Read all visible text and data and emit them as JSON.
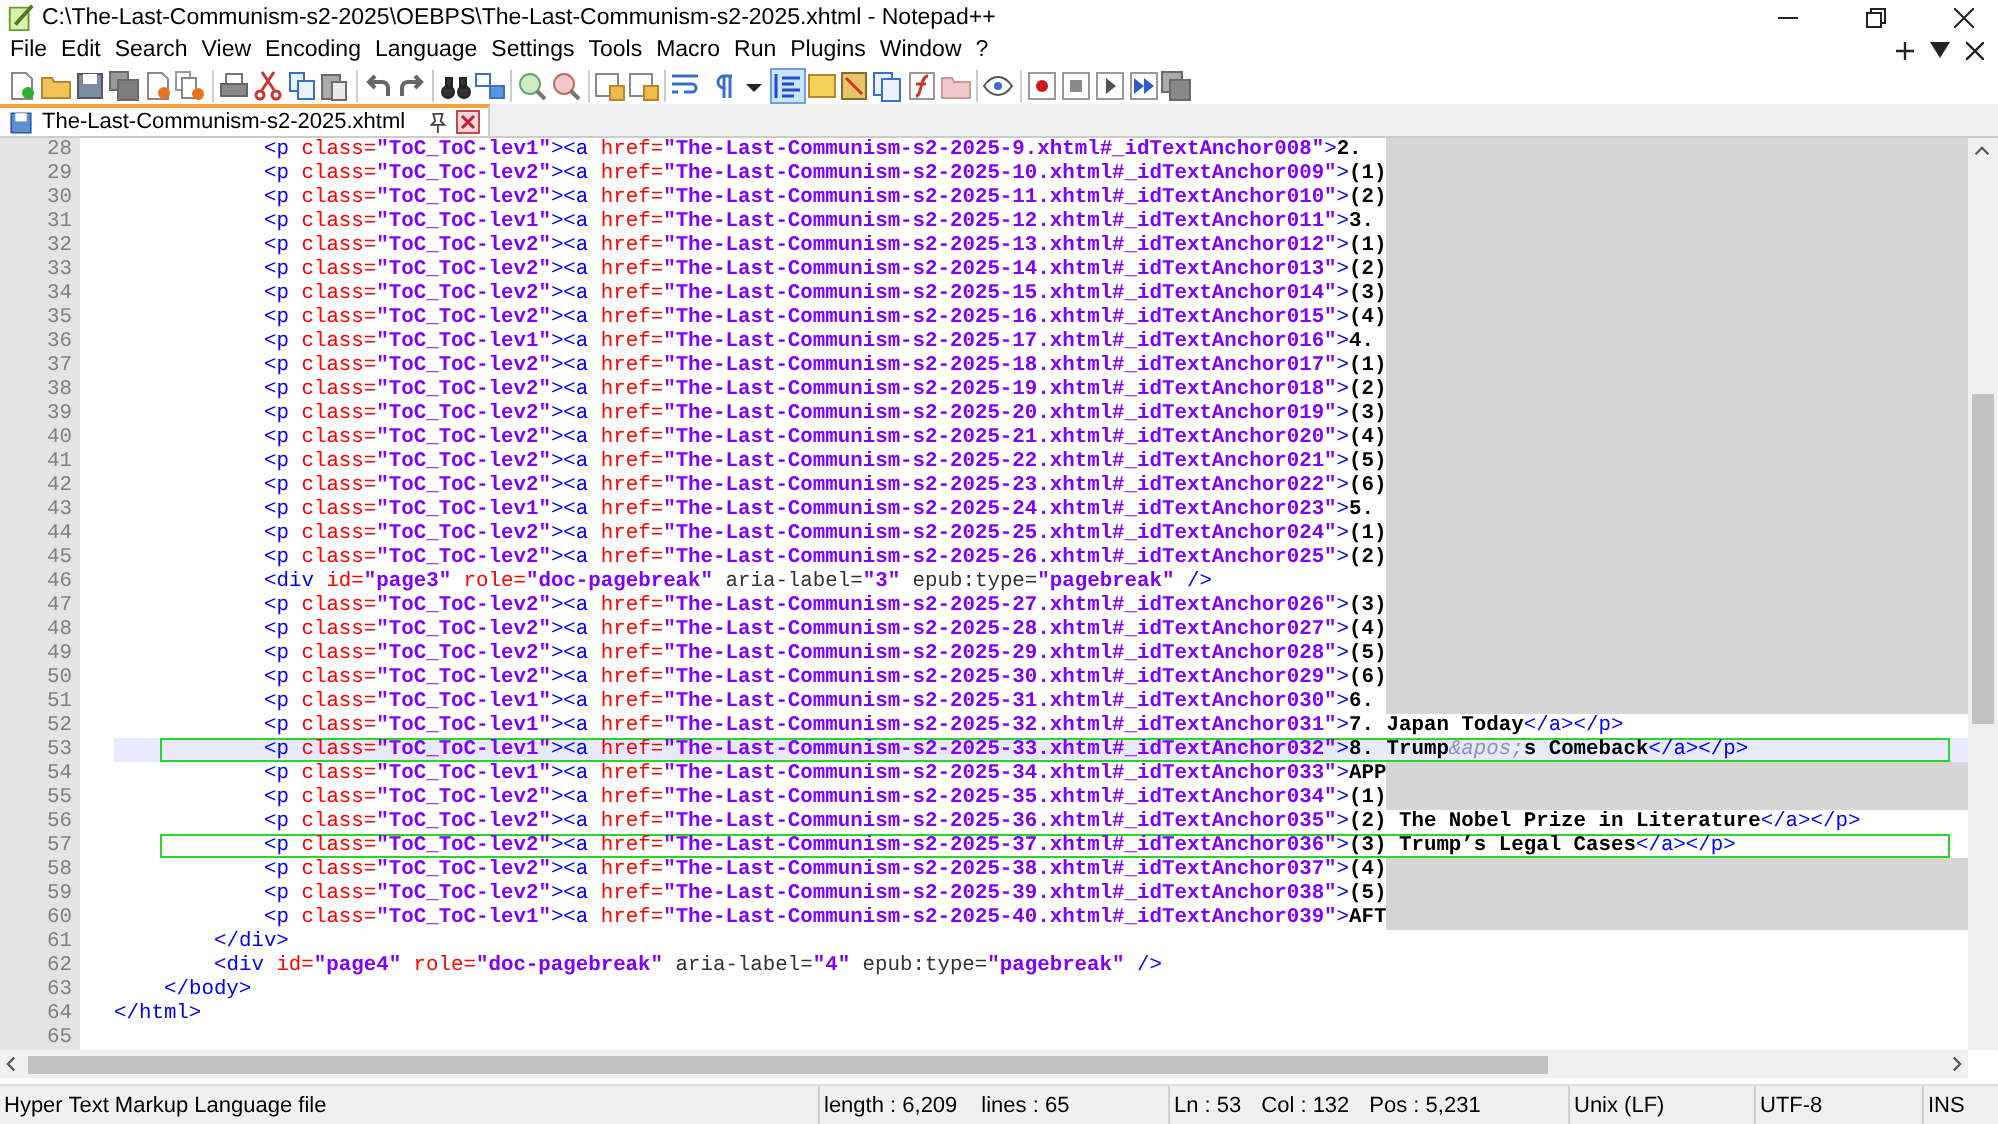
{
  "window": {
    "title": "C:\\The-Last-Communism-s2-2025\\OEBPS\\The-Last-Communism-s2-2025.xhtml - Notepad++"
  },
  "menu": [
    "File",
    "Edit",
    "Search",
    "View",
    "Encoding",
    "Language",
    "Settings",
    "Tools",
    "Macro",
    "Run",
    "Plugins",
    "Window",
    "?"
  ],
  "toolbar": {
    "indent_guide_selected": true
  },
  "tabs": [
    {
      "label": "The-Last-Communism-s2-2025.xhtml",
      "selected": true
    }
  ],
  "editor": {
    "lines": [
      {
        "num": "28",
        "current": false,
        "boxed": false,
        "redacted": true,
        "tokens": [
          {
            "kind": "tag",
            "text": "\t\t\t<p"
          },
          {
            "kind": "attr",
            "text": " class="
          },
          {
            "kind": "value",
            "text": "\"ToC_ToC-lev1\""
          },
          {
            "kind": "tag",
            "text": "><a"
          },
          {
            "kind": "attr",
            "text": " href="
          },
          {
            "kind": "value",
            "text": "\"The-Last-Communism-s2-2025-9.xhtml#_idTextAnchor008\""
          },
          {
            "kind": "tag",
            "text": ">"
          },
          {
            "kind": "text",
            "text": "2."
          }
        ]
      },
      {
        "num": "29",
        "current": false,
        "boxed": false,
        "redacted": true,
        "tokens": [
          {
            "kind": "tag",
            "text": "\t\t\t<p"
          },
          {
            "kind": "attr",
            "text": " class="
          },
          {
            "kind": "value",
            "text": "\"ToC_ToC-lev2\""
          },
          {
            "kind": "tag",
            "text": "><a"
          },
          {
            "kind": "attr",
            "text": " href="
          },
          {
            "kind": "value",
            "text": "\"The-Last-Communism-s2-2025-10.xhtml#_idTextAnchor009\""
          },
          {
            "kind": "tag",
            "text": ">"
          },
          {
            "kind": "text",
            "text": "(1)"
          }
        ]
      },
      {
        "num": "30",
        "current": false,
        "boxed": false,
        "redacted": true,
        "tokens": [
          {
            "kind": "tag",
            "text": "\t\t\t<p"
          },
          {
            "kind": "attr",
            "text": " class="
          },
          {
            "kind": "value",
            "text": "\"ToC_ToC-lev2\""
          },
          {
            "kind": "tag",
            "text": "><a"
          },
          {
            "kind": "attr",
            "text": " href="
          },
          {
            "kind": "value",
            "text": "\"The-Last-Communism-s2-2025-11.xhtml#_idTextAnchor010\""
          },
          {
            "kind": "tag",
            "text": ">"
          },
          {
            "kind": "text",
            "text": "(2)"
          }
        ]
      },
      {
        "num": "31",
        "current": false,
        "boxed": false,
        "redacted": true,
        "tokens": [
          {
            "kind": "tag",
            "text": "\t\t\t<p"
          },
          {
            "kind": "attr",
            "text": " class="
          },
          {
            "kind": "value",
            "text": "\"ToC_ToC-lev1\""
          },
          {
            "kind": "tag",
            "text": "><a"
          },
          {
            "kind": "attr",
            "text": " href="
          },
          {
            "kind": "value",
            "text": "\"The-Last-Communism-s2-2025-12.xhtml#_idTextAnchor011\""
          },
          {
            "kind": "tag",
            "text": ">"
          },
          {
            "kind": "text",
            "text": "3."
          }
        ]
      },
      {
        "num": "32",
        "current": false,
        "boxed": false,
        "redacted": true,
        "tokens": [
          {
            "kind": "tag",
            "text": "\t\t\t<p"
          },
          {
            "kind": "attr",
            "text": " class="
          },
          {
            "kind": "value",
            "text": "\"ToC_ToC-lev2\""
          },
          {
            "kind": "tag",
            "text": "><a"
          },
          {
            "kind": "attr",
            "text": " href="
          },
          {
            "kind": "value",
            "text": "\"The-Last-Communism-s2-2025-13.xhtml#_idTextAnchor012\""
          },
          {
            "kind": "tag",
            "text": ">"
          },
          {
            "kind": "text",
            "text": "(1)"
          }
        ]
      },
      {
        "num": "33",
        "current": false,
        "boxed": false,
        "redacted": true,
        "tokens": [
          {
            "kind": "tag",
            "text": "\t\t\t<p"
          },
          {
            "kind": "attr",
            "text": " class="
          },
          {
            "kind": "value",
            "text": "\"ToC_ToC-lev2\""
          },
          {
            "kind": "tag",
            "text": "><a"
          },
          {
            "kind": "attr",
            "text": " href="
          },
          {
            "kind": "value",
            "text": "\"The-Last-Communism-s2-2025-14.xhtml#_idTextAnchor013\""
          },
          {
            "kind": "tag",
            "text": ">"
          },
          {
            "kind": "text",
            "text": "(2)"
          }
        ]
      },
      {
        "num": "34",
        "current": false,
        "boxed": false,
        "redacted": true,
        "tokens": [
          {
            "kind": "tag",
            "text": "\t\t\t<p"
          },
          {
            "kind": "attr",
            "text": " class="
          },
          {
            "kind": "value",
            "text": "\"ToC_ToC-lev2\""
          },
          {
            "kind": "tag",
            "text": "><a"
          },
          {
            "kind": "attr",
            "text": " href="
          },
          {
            "kind": "value",
            "text": "\"The-Last-Communism-s2-2025-15.xhtml#_idTextAnchor014\""
          },
          {
            "kind": "tag",
            "text": ">"
          },
          {
            "kind": "text",
            "text": "(3)"
          }
        ]
      },
      {
        "num": "35",
        "current": false,
        "boxed": false,
        "redacted": true,
        "tokens": [
          {
            "kind": "tag",
            "text": "\t\t\t<p"
          },
          {
            "kind": "attr",
            "text": " class="
          },
          {
            "kind": "value",
            "text": "\"ToC_ToC-lev2\""
          },
          {
            "kind": "tag",
            "text": "><a"
          },
          {
            "kind": "attr",
            "text": " href="
          },
          {
            "kind": "value",
            "text": "\"The-Last-Communism-s2-2025-16.xhtml#_idTextAnchor015\""
          },
          {
            "kind": "tag",
            "text": ">"
          },
          {
            "kind": "text",
            "text": "(4)"
          }
        ]
      },
      {
        "num": "36",
        "current": false,
        "boxed": false,
        "redacted": true,
        "tokens": [
          {
            "kind": "tag",
            "text": "\t\t\t<p"
          },
          {
            "kind": "attr",
            "text": " class="
          },
          {
            "kind": "value",
            "text": "\"ToC_ToC-lev1\""
          },
          {
            "kind": "tag",
            "text": "><a"
          },
          {
            "kind": "attr",
            "text": " href="
          },
          {
            "kind": "value",
            "text": "\"The-Last-Communism-s2-2025-17.xhtml#_idTextAnchor016\""
          },
          {
            "kind": "tag",
            "text": ">"
          },
          {
            "kind": "text",
            "text": "4."
          }
        ]
      },
      {
        "num": "37",
        "current": false,
        "boxed": false,
        "redacted": true,
        "tokens": [
          {
            "kind": "tag",
            "text": "\t\t\t<p"
          },
          {
            "kind": "attr",
            "text": " class="
          },
          {
            "kind": "value",
            "text": "\"ToC_ToC-lev2\""
          },
          {
            "kind": "tag",
            "text": "><a"
          },
          {
            "kind": "attr",
            "text": " href="
          },
          {
            "kind": "value",
            "text": "\"The-Last-Communism-s2-2025-18.xhtml#_idTextAnchor017\""
          },
          {
            "kind": "tag",
            "text": ">"
          },
          {
            "kind": "text",
            "text": "(1)"
          }
        ]
      },
      {
        "num": "38",
        "current": false,
        "boxed": false,
        "redacted": true,
        "tokens": [
          {
            "kind": "tag",
            "text": "\t\t\t<p"
          },
          {
            "kind": "attr",
            "text": " class="
          },
          {
            "kind": "value",
            "text": "\"ToC_ToC-lev2\""
          },
          {
            "kind": "tag",
            "text": "><a"
          },
          {
            "kind": "attr",
            "text": " href="
          },
          {
            "kind": "value",
            "text": "\"The-Last-Communism-s2-2025-19.xhtml#_idTextAnchor018\""
          },
          {
            "kind": "tag",
            "text": ">"
          },
          {
            "kind": "text",
            "text": "(2)"
          }
        ]
      },
      {
        "num": "39",
        "current": false,
        "boxed": false,
        "redacted": true,
        "tokens": [
          {
            "kind": "tag",
            "text": "\t\t\t<p"
          },
          {
            "kind": "attr",
            "text": " class="
          },
          {
            "kind": "value",
            "text": "\"ToC_ToC-lev2\""
          },
          {
            "kind": "tag",
            "text": "><a"
          },
          {
            "kind": "attr",
            "text": " href="
          },
          {
            "kind": "value",
            "text": "\"The-Last-Communism-s2-2025-20.xhtml#_idTextAnchor019\""
          },
          {
            "kind": "tag",
            "text": ">"
          },
          {
            "kind": "text",
            "text": "(3)"
          }
        ]
      },
      {
        "num": "40",
        "current": false,
        "boxed": false,
        "redacted": true,
        "tokens": [
          {
            "kind": "tag",
            "text": "\t\t\t<p"
          },
          {
            "kind": "attr",
            "text": " class="
          },
          {
            "kind": "value",
            "text": "\"ToC_ToC-lev2\""
          },
          {
            "kind": "tag",
            "text": "><a"
          },
          {
            "kind": "attr",
            "text": " href="
          },
          {
            "kind": "value",
            "text": "\"The-Last-Communism-s2-2025-21.xhtml#_idTextAnchor020\""
          },
          {
            "kind": "tag",
            "text": ">"
          },
          {
            "kind": "text",
            "text": "(4)"
          }
        ]
      },
      {
        "num": "41",
        "current": false,
        "boxed": false,
        "redacted": true,
        "tokens": [
          {
            "kind": "tag",
            "text": "\t\t\t<p"
          },
          {
            "kind": "attr",
            "text": " class="
          },
          {
            "kind": "value",
            "text": "\"ToC_ToC-lev2\""
          },
          {
            "kind": "tag",
            "text": "><a"
          },
          {
            "kind": "attr",
            "text": " href="
          },
          {
            "kind": "value",
            "text": "\"The-Last-Communism-s2-2025-22.xhtml#_idTextAnchor021\""
          },
          {
            "kind": "tag",
            "text": ">"
          },
          {
            "kind": "text",
            "text": "(5)"
          }
        ]
      },
      {
        "num": "42",
        "current": false,
        "boxed": false,
        "redacted": true,
        "tokens": [
          {
            "kind": "tag",
            "text": "\t\t\t<p"
          },
          {
            "kind": "attr",
            "text": " class="
          },
          {
            "kind": "value",
            "text": "\"ToC_ToC-lev2\""
          },
          {
            "kind": "tag",
            "text": "><a"
          },
          {
            "kind": "attr",
            "text": " href="
          },
          {
            "kind": "value",
            "text": "\"The-Last-Communism-s2-2025-23.xhtml#_idTextAnchor022\""
          },
          {
            "kind": "tag",
            "text": ">"
          },
          {
            "kind": "text",
            "text": "(6)"
          }
        ]
      },
      {
        "num": "43",
        "current": false,
        "boxed": false,
        "redacted": true,
        "tokens": [
          {
            "kind": "tag",
            "text": "\t\t\t<p"
          },
          {
            "kind": "attr",
            "text": " class="
          },
          {
            "kind": "value",
            "text": "\"ToC_ToC-lev1\""
          },
          {
            "kind": "tag",
            "text": "><a"
          },
          {
            "kind": "attr",
            "text": " href="
          },
          {
            "kind": "value",
            "text": "\"The-Last-Communism-s2-2025-24.xhtml#_idTextAnchor023\""
          },
          {
            "kind": "tag",
            "text": ">"
          },
          {
            "kind": "text",
            "text": "5."
          }
        ]
      },
      {
        "num": "44",
        "current": false,
        "boxed": false,
        "redacted": true,
        "tokens": [
          {
            "kind": "tag",
            "text": "\t\t\t<p"
          },
          {
            "kind": "attr",
            "text": " class="
          },
          {
            "kind": "value",
            "text": "\"ToC_ToC-lev2\""
          },
          {
            "kind": "tag",
            "text": "><a"
          },
          {
            "kind": "attr",
            "text": " href="
          },
          {
            "kind": "value",
            "text": "\"The-Last-Communism-s2-2025-25.xhtml#_idTextAnchor024\""
          },
          {
            "kind": "tag",
            "text": ">"
          },
          {
            "kind": "text",
            "text": "(1)"
          }
        ]
      },
      {
        "num": "45",
        "current": false,
        "boxed": false,
        "redacted": true,
        "tokens": [
          {
            "kind": "tag",
            "text": "\t\t\t<p"
          },
          {
            "kind": "attr",
            "text": " class="
          },
          {
            "kind": "value",
            "text": "\"ToC_ToC-lev2\""
          },
          {
            "kind": "tag",
            "text": "><a"
          },
          {
            "kind": "attr",
            "text": " href="
          },
          {
            "kind": "value",
            "text": "\"The-Last-Communism-s2-2025-26.xhtml#_idTextAnchor025\""
          },
          {
            "kind": "tag",
            "text": ">"
          },
          {
            "kind": "text",
            "text": "(2)"
          }
        ]
      },
      {
        "num": "46",
        "current": false,
        "boxed": false,
        "redacted": true,
        "tokens": [
          {
            "kind": "tag",
            "text": "\t\t\t<div"
          },
          {
            "kind": "attr",
            "text": " id="
          },
          {
            "kind": "value",
            "text": "\"page3\""
          },
          {
            "kind": "attr",
            "text": " role="
          },
          {
            "kind": "value",
            "text": "\"doc-pagebreak\""
          },
          {
            "kind": "other",
            "text": " aria-label="
          },
          {
            "kind": "value",
            "text": "\"3\""
          },
          {
            "kind": "other",
            "text": " epub:type="
          },
          {
            "kind": "value",
            "text": "\"pagebreak\""
          },
          {
            "kind": "tag",
            "text": " />"
          }
        ]
      },
      {
        "num": "47",
        "current": false,
        "boxed": false,
        "redacted": true,
        "tokens": [
          {
            "kind": "tag",
            "text": "\t\t\t<p"
          },
          {
            "kind": "attr",
            "text": " class="
          },
          {
            "kind": "value",
            "text": "\"ToC_ToC-lev2\""
          },
          {
            "kind": "tag",
            "text": "><a"
          },
          {
            "kind": "attr",
            "text": " href="
          },
          {
            "kind": "value",
            "text": "\"The-Last-Communism-s2-2025-27.xhtml#_idTextAnchor026\""
          },
          {
            "kind": "tag",
            "text": ">"
          },
          {
            "kind": "text",
            "text": "(3)"
          }
        ]
      },
      {
        "num": "48",
        "current": false,
        "boxed": false,
        "redacted": true,
        "tokens": [
          {
            "kind": "tag",
            "text": "\t\t\t<p"
          },
          {
            "kind": "attr",
            "text": " class="
          },
          {
            "kind": "value",
            "text": "\"ToC_ToC-lev2\""
          },
          {
            "kind": "tag",
            "text": "><a"
          },
          {
            "kind": "attr",
            "text": " href="
          },
          {
            "kind": "value",
            "text": "\"The-Last-Communism-s2-2025-28.xhtml#_idTextAnchor027\""
          },
          {
            "kind": "tag",
            "text": ">"
          },
          {
            "kind": "text",
            "text": "(4)"
          }
        ]
      },
      {
        "num": "49",
        "current": false,
        "boxed": false,
        "redacted": true,
        "tokens": [
          {
            "kind": "tag",
            "text": "\t\t\t<p"
          },
          {
            "kind": "attr",
            "text": " class="
          },
          {
            "kind": "value",
            "text": "\"ToC_ToC-lev2\""
          },
          {
            "kind": "tag",
            "text": "><a"
          },
          {
            "kind": "attr",
            "text": " href="
          },
          {
            "kind": "value",
            "text": "\"The-Last-Communism-s2-2025-29.xhtml#_idTextAnchor028\""
          },
          {
            "kind": "tag",
            "text": ">"
          },
          {
            "kind": "text",
            "text": "(5)"
          }
        ]
      },
      {
        "num": "50",
        "current": false,
        "boxed": false,
        "redacted": true,
        "tokens": [
          {
            "kind": "tag",
            "text": "\t\t\t<p"
          },
          {
            "kind": "attr",
            "text": " class="
          },
          {
            "kind": "value",
            "text": "\"ToC_ToC-lev2\""
          },
          {
            "kind": "tag",
            "text": "><a"
          },
          {
            "kind": "attr",
            "text": " href="
          },
          {
            "kind": "value",
            "text": "\"The-Last-Communism-s2-2025-30.xhtml#_idTextAnchor029\""
          },
          {
            "kind": "tag",
            "text": ">"
          },
          {
            "kind": "text",
            "text": "(6)"
          }
        ]
      },
      {
        "num": "51",
        "current": false,
        "boxed": false,
        "redacted": true,
        "tokens": [
          {
            "kind": "tag",
            "text": "\t\t\t<p"
          },
          {
            "kind": "attr",
            "text": " class="
          },
          {
            "kind": "value",
            "text": "\"ToC_ToC-lev1\""
          },
          {
            "kind": "tag",
            "text": "><a"
          },
          {
            "kind": "attr",
            "text": " href="
          },
          {
            "kind": "value",
            "text": "\"The-Last-Communism-s2-2025-31.xhtml#_idTextAnchor030\""
          },
          {
            "kind": "tag",
            "text": ">"
          },
          {
            "kind": "text",
            "text": "6."
          }
        ]
      },
      {
        "num": "52",
        "current": false,
        "boxed": false,
        "redacted": false,
        "tokens": [
          {
            "kind": "tag",
            "text": "\t\t\t<p"
          },
          {
            "kind": "attr",
            "text": " class="
          },
          {
            "kind": "value",
            "text": "\"ToC_ToC-lev1\""
          },
          {
            "kind": "tag",
            "text": "><a"
          },
          {
            "kind": "attr",
            "text": " href="
          },
          {
            "kind": "value",
            "text": "\"The-Last-Communism-s2-2025-32.xhtml#_idTextAnchor031\""
          },
          {
            "kind": "tag",
            "text": ">"
          },
          {
            "kind": "text",
            "text": "7. Japan Today"
          },
          {
            "kind": "tag",
            "text": "</a></p>"
          }
        ]
      },
      {
        "num": "53",
        "current": true,
        "boxed": true,
        "redacted": false,
        "tokens": [
          {
            "kind": "tag",
            "text": "\t\t\t<p"
          },
          {
            "kind": "attr",
            "text": " class="
          },
          {
            "kind": "value",
            "text": "\"ToC_ToC-lev1\""
          },
          {
            "kind": "tag",
            "text": "><a"
          },
          {
            "kind": "attr",
            "text": " href="
          },
          {
            "kind": "value",
            "text": "\"The-Last-Communism-s2-2025-33.xhtml#_idTextAnchor032\""
          },
          {
            "kind": "tag",
            "text": ">"
          },
          {
            "kind": "text",
            "text": "8. Trump"
          },
          {
            "kind": "entity",
            "text": "&apos;"
          },
          {
            "kind": "text",
            "text": "s Comeback"
          },
          {
            "kind": "tag",
            "text": "</a></p>"
          }
        ]
      },
      {
        "num": "54",
        "current": false,
        "boxed": false,
        "redacted": true,
        "tokens": [
          {
            "kind": "tag",
            "text": "\t\t\t<p"
          },
          {
            "kind": "attr",
            "text": " class="
          },
          {
            "kind": "value",
            "text": "\"ToC_ToC-lev1\""
          },
          {
            "kind": "tag",
            "text": "><a"
          },
          {
            "kind": "attr",
            "text": " href="
          },
          {
            "kind": "value",
            "text": "\"The-Last-Communism-s2-2025-34.xhtml#_idTextAnchor033\""
          },
          {
            "kind": "tag",
            "text": ">"
          },
          {
            "kind": "text",
            "text": "APP"
          }
        ]
      },
      {
        "num": "55",
        "current": false,
        "boxed": false,
        "redacted": true,
        "tokens": [
          {
            "kind": "tag",
            "text": "\t\t\t<p"
          },
          {
            "kind": "attr",
            "text": " class="
          },
          {
            "kind": "value",
            "text": "\"ToC_ToC-lev2\""
          },
          {
            "kind": "tag",
            "text": "><a"
          },
          {
            "kind": "attr",
            "text": " href="
          },
          {
            "kind": "value",
            "text": "\"The-Last-Communism-s2-2025-35.xhtml#_idTextAnchor034\""
          },
          {
            "kind": "tag",
            "text": ">"
          },
          {
            "kind": "text",
            "text": "(1)"
          }
        ]
      },
      {
        "num": "56",
        "current": false,
        "boxed": false,
        "redacted": false,
        "tokens": [
          {
            "kind": "tag",
            "text": "\t\t\t<p"
          },
          {
            "kind": "attr",
            "text": " class="
          },
          {
            "kind": "value",
            "text": "\"ToC_ToC-lev2\""
          },
          {
            "kind": "tag",
            "text": "><a"
          },
          {
            "kind": "attr",
            "text": " href="
          },
          {
            "kind": "value",
            "text": "\"The-Last-Communism-s2-2025-36.xhtml#_idTextAnchor035\""
          },
          {
            "kind": "tag",
            "text": ">"
          },
          {
            "kind": "text",
            "text": "(2) The Nobel Prize in Literature"
          },
          {
            "kind": "tag",
            "text": "</a></p>"
          }
        ]
      },
      {
        "num": "57",
        "current": false,
        "boxed": true,
        "redacted": false,
        "tokens": [
          {
            "kind": "tag",
            "text": "\t\t\t<p"
          },
          {
            "kind": "attr",
            "text": " class="
          },
          {
            "kind": "value",
            "text": "\"ToC_ToC-lev2\""
          },
          {
            "kind": "tag",
            "text": "><a"
          },
          {
            "kind": "attr",
            "text": " href="
          },
          {
            "kind": "value",
            "text": "\"The-Last-Communism-s2-2025-37.xhtml#_idTextAnchor036\""
          },
          {
            "kind": "tag",
            "text": ">"
          },
          {
            "kind": "text",
            "text": "(3) Trump’s Legal Cases"
          },
          {
            "kind": "tag",
            "text": "</a></p>"
          }
        ]
      },
      {
        "num": "58",
        "current": false,
        "boxed": false,
        "redacted": true,
        "tokens": [
          {
            "kind": "tag",
            "text": "\t\t\t<p"
          },
          {
            "kind": "attr",
            "text": " class="
          },
          {
            "kind": "value",
            "text": "\"ToC_ToC-lev2\""
          },
          {
            "kind": "tag",
            "text": "><a"
          },
          {
            "kind": "attr",
            "text": " href="
          },
          {
            "kind": "value",
            "text": "\"The-Last-Communism-s2-2025-38.xhtml#_idTextAnchor037\""
          },
          {
            "kind": "tag",
            "text": ">"
          },
          {
            "kind": "text",
            "text": "(4)"
          }
        ]
      },
      {
        "num": "59",
        "current": false,
        "boxed": false,
        "redacted": true,
        "tokens": [
          {
            "kind": "tag",
            "text": "\t\t\t<p"
          },
          {
            "kind": "attr",
            "text": " class="
          },
          {
            "kind": "value",
            "text": "\"ToC_ToC-lev2\""
          },
          {
            "kind": "tag",
            "text": "><a"
          },
          {
            "kind": "attr",
            "text": " href="
          },
          {
            "kind": "value",
            "text": "\"The-Last-Communism-s2-2025-39.xhtml#_idTextAnchor038\""
          },
          {
            "kind": "tag",
            "text": ">"
          },
          {
            "kind": "text",
            "text": "(5)"
          }
        ]
      },
      {
        "num": "60",
        "current": false,
        "boxed": false,
        "redacted": true,
        "tokens": [
          {
            "kind": "tag",
            "text": "\t\t\t<p"
          },
          {
            "kind": "attr",
            "text": " class="
          },
          {
            "kind": "value",
            "text": "\"ToC_ToC-lev1\""
          },
          {
            "kind": "tag",
            "text": "><a"
          },
          {
            "kind": "attr",
            "text": " href="
          },
          {
            "kind": "value",
            "text": "\"The-Last-Communism-s2-2025-40.xhtml#_idTextAnchor039\""
          },
          {
            "kind": "tag",
            "text": ">"
          },
          {
            "kind": "text",
            "text": "AFT"
          }
        ]
      },
      {
        "num": "61",
        "current": false,
        "boxed": false,
        "redacted": false,
        "tokens": [
          {
            "kind": "tag",
            "text": "\t\t</div>"
          }
        ]
      },
      {
        "num": "62",
        "current": false,
        "boxed": false,
        "redacted": false,
        "tokens": [
          {
            "kind": "tag",
            "text": "\t\t<div"
          },
          {
            "kind": "attr",
            "text": " id="
          },
          {
            "kind": "value",
            "text": "\"page4\""
          },
          {
            "kind": "attr",
            "text": " role="
          },
          {
            "kind": "value",
            "text": "\"doc-pagebreak\""
          },
          {
            "kind": "other",
            "text": " aria-label="
          },
          {
            "kind": "value",
            "text": "\"4\""
          },
          {
            "kind": "other",
            "text": " epub:type="
          },
          {
            "kind": "value",
            "text": "\"pagebreak\""
          },
          {
            "kind": "tag",
            "text": " />"
          }
        ]
      },
      {
        "num": "63",
        "current": false,
        "boxed": false,
        "redacted": false,
        "tokens": [
          {
            "kind": "tag",
            "text": "\t</body>"
          }
        ]
      },
      {
        "num": "64",
        "current": false,
        "boxed": false,
        "redacted": false,
        "tokens": [
          {
            "kind": "tag",
            "text": "</html>"
          }
        ]
      },
      {
        "num": "65",
        "current": false,
        "boxed": false,
        "redacted": false
      }
    ]
  },
  "status_bar": {
    "file_type": "Hyper Text Markup Language file",
    "length": "length : 6,209",
    "lines": "lines : 65",
    "line": "Ln : 53",
    "column": "Col : 132",
    "position": "Pos : 5,231",
    "eol": "Unix (LF)",
    "encoding": "UTF-8",
    "mode": "INS"
  }
}
